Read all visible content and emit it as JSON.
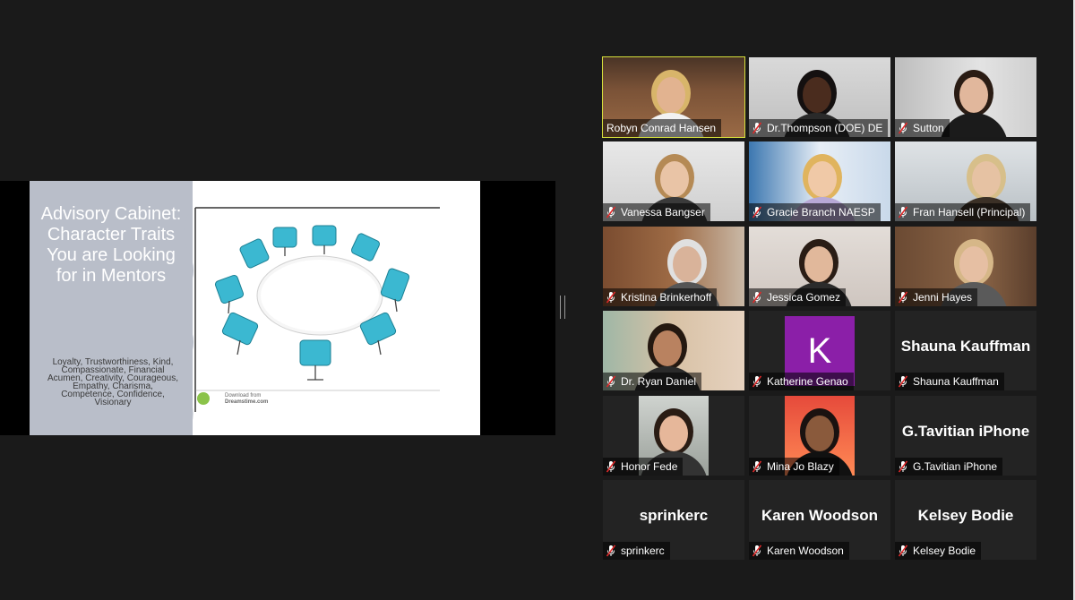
{
  "slide": {
    "title": "Advisory Cabinet: Character Traits You are Looking for in Mentors",
    "body": "Loyalty, Trustworthiness, Kind, Compassionate, Financial Acumen, Creativity, Courageous, Empathy, Charisma, Competence, Confidence, Visionary",
    "download_line1": "Download from",
    "download_line2": "Dreamstime.com"
  },
  "participants": [
    {
      "name": "Robyn Conrad Hansen",
      "muted": false,
      "active": true,
      "video": true
    },
    {
      "name": "Dr.Thompson (DOE) DE",
      "muted": true,
      "video": true
    },
    {
      "name": "Sutton",
      "muted": true,
      "video": true
    },
    {
      "name": "Vanessa Bangser",
      "muted": true,
      "video": true
    },
    {
      "name": "Gracie Branch NAESP",
      "muted": true,
      "video": true
    },
    {
      "name": "Fran Hansell (Principal)",
      "muted": true,
      "video": true
    },
    {
      "name": "Kristina Brinkerhoff",
      "muted": true,
      "video": true
    },
    {
      "name": "Jessica Gomez",
      "muted": true,
      "video": true
    },
    {
      "name": "Jenni Hayes",
      "muted": true,
      "video": true
    },
    {
      "name": "Dr. Ryan Daniel",
      "muted": true,
      "video": true
    },
    {
      "name": "Katherine Genao",
      "muted": true,
      "avatar_letter": "K"
    },
    {
      "name": "Shauna Kauffman",
      "muted": true,
      "big_name": "Shauna Kauffman"
    },
    {
      "name": "Honor Fede",
      "muted": true,
      "video": true
    },
    {
      "name": "Mina Jo Blazy",
      "muted": true,
      "video": true
    },
    {
      "name": "G.Tavitian iPhone",
      "muted": true,
      "big_name": "G.Tavitian iPhone"
    },
    {
      "name": "sprinkerc",
      "muted": true,
      "big_name": "sprinkerc"
    },
    {
      "name": "Karen Woodson",
      "muted": true,
      "big_name": "Karen Woodson"
    },
    {
      "name": "Kelsey Bodie",
      "muted": true,
      "big_name": "Kelsey Bodie"
    }
  ],
  "colors": {
    "active_border": "#d6e03c",
    "muted_icon": "#e02828",
    "avatar_bg": "#8b1fa8"
  }
}
